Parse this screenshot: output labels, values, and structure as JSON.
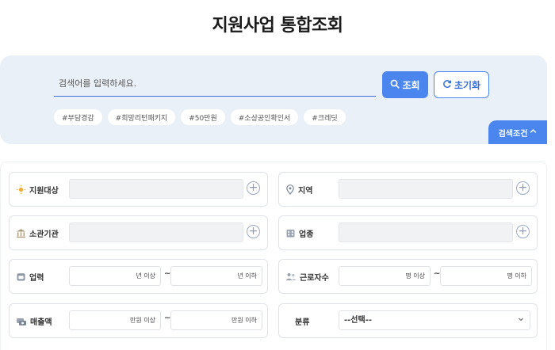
{
  "page": {
    "title": "지원사업 통합조회"
  },
  "search": {
    "placeholder": "검색어를 입력하세요.",
    "search_button": "조회",
    "reset_button": "초기화",
    "tags": [
      "#부담경감",
      "#희망리턴패키지",
      "#50만원",
      "#소상공인확인서",
      "#크레딧"
    ],
    "conditions_toggle": "검색조건"
  },
  "filters": {
    "support_target": {
      "label": "지원대상"
    },
    "region": {
      "label": "지역"
    },
    "agency": {
      "label": "소관기관"
    },
    "industry": {
      "label": "업종"
    },
    "business_years": {
      "label": "업력",
      "min_suffix": "년 이상",
      "max_suffix": "년 이하"
    },
    "employees": {
      "label": "근로자수",
      "min_suffix": "명 이상",
      "max_suffix": "명 이하"
    },
    "revenue": {
      "label": "매출액",
      "min_suffix": "만원 이상",
      "max_suffix": "만원 이하"
    },
    "category": {
      "label": "분류",
      "selected": "--선택--"
    },
    "range_separator": "~"
  },
  "colors": {
    "accent": "#4b86ee",
    "panel_bg": "#eaf0f7"
  },
  "icons": {
    "search": "search-icon",
    "reset": "refresh-icon",
    "chevron": "chevron-up-icon",
    "support_target": "sun-icon",
    "region": "location-pin-icon",
    "agency": "bank-icon",
    "industry": "building-icon",
    "business_years": "calendar-icon",
    "employees": "people-icon",
    "revenue": "money-icon",
    "plus": "plus-circle-icon"
  }
}
